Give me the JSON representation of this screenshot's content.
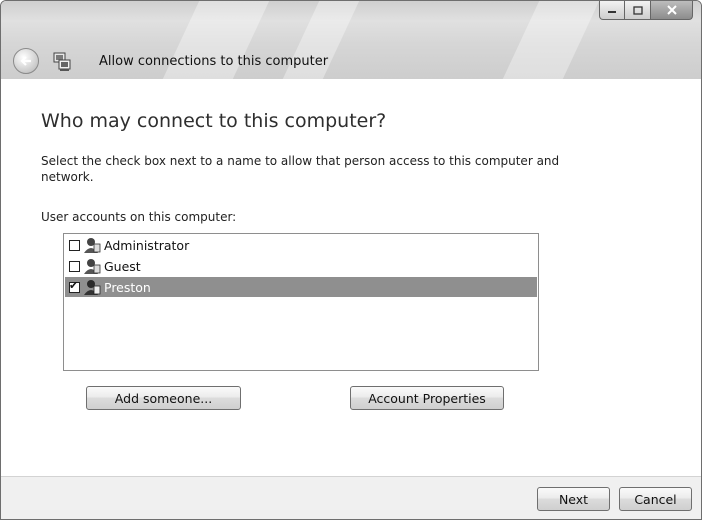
{
  "window": {
    "title": "Allow connections to this computer"
  },
  "page": {
    "heading": "Who may connect to this computer?",
    "description": "Select the check box next to a name to allow that person access to this computer and network.",
    "list_label": "User accounts on this computer:"
  },
  "users": [
    {
      "name": "Administrator",
      "checked": false,
      "selected": false
    },
    {
      "name": "Guest",
      "checked": false,
      "selected": false
    },
    {
      "name": "Preston",
      "checked": true,
      "selected": true
    }
  ],
  "buttons": {
    "add_someone": "Add someone...",
    "account_properties": "Account Properties",
    "next": "Next",
    "cancel": "Cancel"
  },
  "icons": {
    "back": "back-arrow-icon",
    "network": "network-connection-icon",
    "user": "user-account-icon"
  },
  "colors": {
    "selection": "#8f8f8f",
    "footer": "#f0f0f0"
  }
}
